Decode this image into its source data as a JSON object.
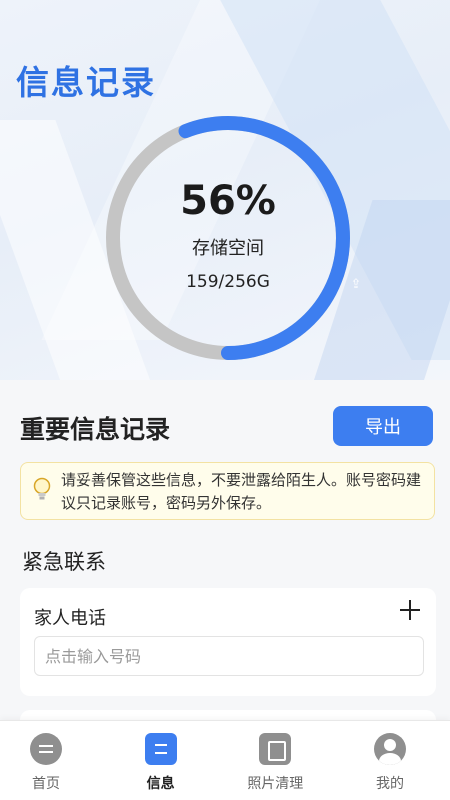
{
  "header": {
    "title": "信息记录"
  },
  "storage": {
    "percent_text": "56%",
    "percent": 56,
    "label": "存储空间",
    "usage": "159/256G"
  },
  "colors": {
    "accent": "#3d7ef0",
    "ring_track": "#c5c5c5",
    "title": "#2f72e3",
    "notice_bg": "#fffdeb"
  },
  "section": {
    "title": "重要信息记录",
    "export_label": "导出",
    "notice": "请妥善保管这些信息，不要泄露给陌生人。账号密码建议只记录账号，密码另外保存。"
  },
  "emergency": {
    "title": "紧急联系",
    "card_label": "家人电话",
    "input_placeholder": "点击输入号码",
    "input_value": ""
  },
  "nav": {
    "items": [
      {
        "label": "首页",
        "icon": "home-icon"
      },
      {
        "label": "信息",
        "icon": "info-icon",
        "active": true
      },
      {
        "label": "照片清理",
        "icon": "photo-icon"
      },
      {
        "label": "我的",
        "icon": "user-icon"
      }
    ]
  }
}
